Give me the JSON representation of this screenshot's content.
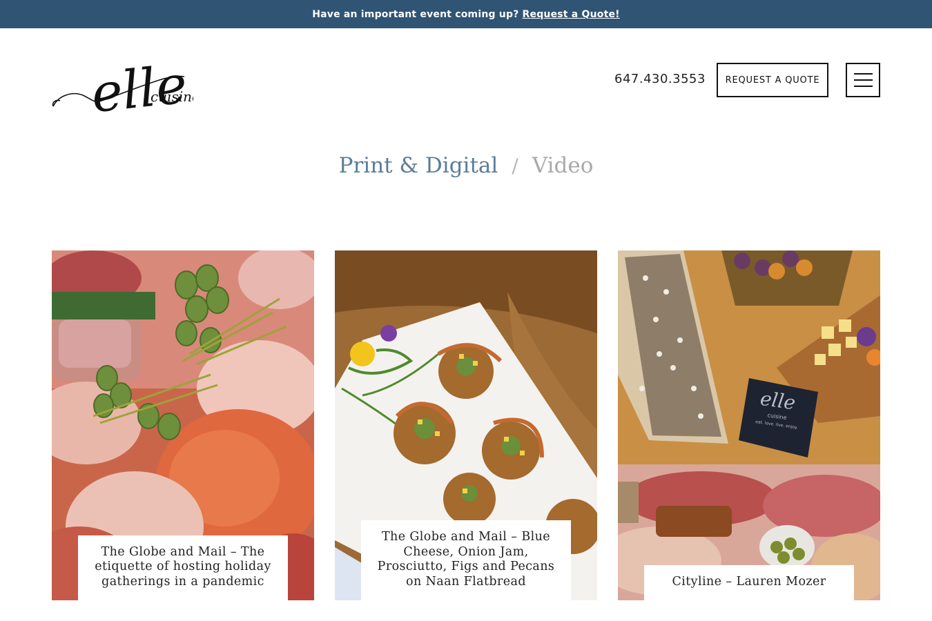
{
  "announcement": {
    "text": "Have an important event coming up?",
    "link_label": "Request a Quote!"
  },
  "header": {
    "logo_text": "elle",
    "logo_subtext": "cuisine",
    "phone": "647.430.3553",
    "quote_button_label": "REQUEST A QUOTE",
    "menu_icon": "hamburger-menu-icon"
  },
  "tabs": {
    "print_digital": "Print & Digital",
    "separator": "/",
    "video": "Video"
  },
  "cards": [
    {
      "caption": "The Globe and Mail – The etiquette of hosting holiday gatherings in a pandemic"
    },
    {
      "caption": "The Globe and Mail – Blue Cheese, Onion Jam, Prosciutto, Figs and Pecans on Naan Flatbread"
    },
    {
      "caption": "Cityline – Lauren Mozer",
      "napkin_brand": "elle",
      "napkin_sub": "cuisine",
      "napkin_tagline": "eat. love. live. enjoy."
    }
  ],
  "colors": {
    "topbar": "#2f5474",
    "tab_active": "#5b7c99",
    "tab_inactive": "#a9a9a9"
  }
}
